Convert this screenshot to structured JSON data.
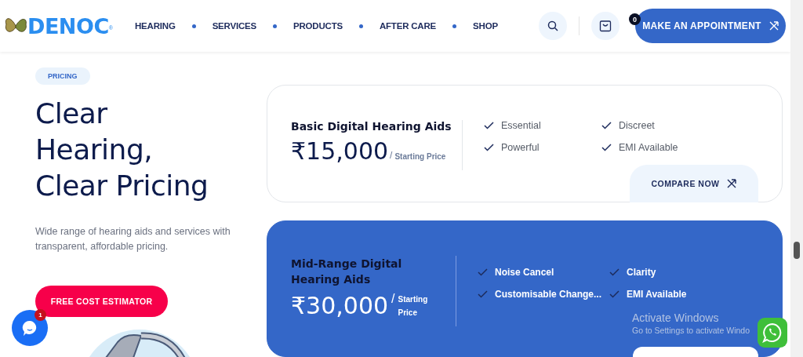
{
  "header": {
    "logo": "DENOC",
    "logo_mark": "®",
    "nav": [
      {
        "label": "HEARING"
      },
      {
        "label": "SERVICES"
      },
      {
        "label": "PRODUCTS"
      },
      {
        "label": "AFTER CARE"
      },
      {
        "label": "SHOP"
      }
    ],
    "cart_count": "0",
    "cta": "MAKE AN APPOINTMENT"
  },
  "hero": {
    "tag": "PRICING",
    "title_lines": [
      "Clear",
      "Hearing,",
      "Clear Pricing"
    ],
    "description": "Wide range of hearing aids and services with transparent, affordable pricing.",
    "button": "FREE COST ESTIMATOR"
  },
  "plans": [
    {
      "name": "Basic Digital Hearing Aids",
      "price": "₹15,000",
      "slash": "/",
      "price_note": "Starting Price",
      "highlighted": false,
      "features": [
        "Essential",
        "Discreet",
        "Powerful",
        "EMI Available"
      ],
      "button": "COMPARE NOW"
    },
    {
      "name": "Mid-Range Digital Hearing Aids",
      "price": "₹30,000",
      "slash": "/",
      "price_note": "Starting Price",
      "highlighted": true,
      "features": [
        "Noise Cancel",
        "Clarity",
        "Customisable Change...",
        "EMI Available"
      ]
    }
  ],
  "chat_badge": "1",
  "os_overlay": {
    "title": "Activate Windows",
    "subtitle": "Go to Settings to activate Windo"
  }
}
